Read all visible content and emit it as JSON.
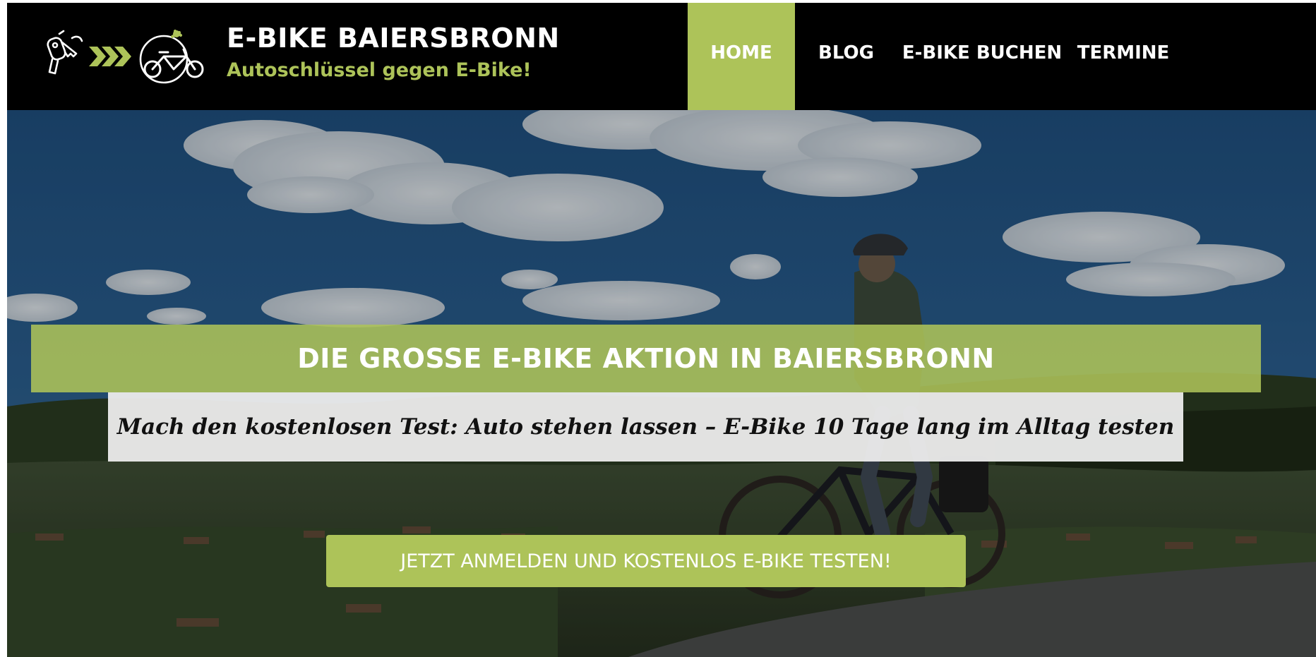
{
  "header": {
    "brand_title": "E-BIKE BAIERSBRONN",
    "brand_subtitle": "Autoschlüssel gegen E-Bike!",
    "logo_icons": [
      "car-key-icon",
      "chevrons-right-icon",
      "e-bike-icon"
    ]
  },
  "nav": {
    "items": [
      {
        "label": "HOME",
        "active": true
      },
      {
        "label": "BLOG",
        "active": false
      },
      {
        "label": "E-BIKE BUCHEN",
        "active": false
      },
      {
        "label": "TERMINE",
        "active": false
      }
    ]
  },
  "hero": {
    "headline": "DIE GROSSE E-BIKE AKTION IN BAIERSBRONN",
    "tagline": "Mach den kostenlosen Test: Auto stehen lassen – E-Bike 10 Tage lang im Alltag testen",
    "cta_label": "JETZT ANMELDEN UND KOSTENLOS E-BIKE TESTEN!",
    "background_icon": "cyclist-landscape-photo"
  },
  "colors": {
    "accent": "#adc359",
    "header_bg": "#000000",
    "nav_text": "#ffffff",
    "tagline_bg": "#eeeeee"
  }
}
